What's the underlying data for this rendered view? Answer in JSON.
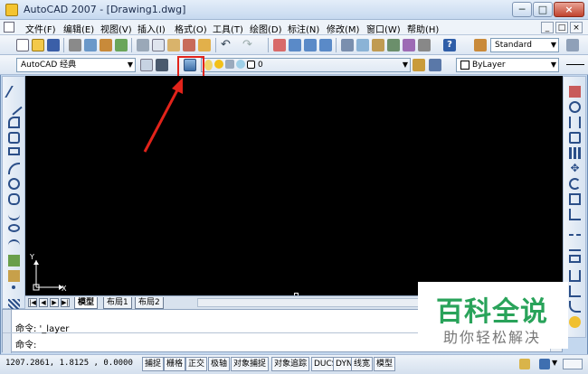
{
  "window": {
    "title": "AutoCAD 2007 - [Drawing1.dwg]",
    "min_label": "─",
    "max_label": "□",
    "close_label": "×"
  },
  "menu": {
    "items": [
      "文件(F)",
      "编辑(E)",
      "视图(V)",
      "插入(I)",
      "格式(O)",
      "工具(T)",
      "绘图(D)",
      "标注(N)",
      "修改(M)",
      "窗口(W)",
      "帮助(H)"
    ],
    "mdi_min": "_",
    "mdi_restore": "□",
    "mdi_close": "×"
  },
  "toolbar": {
    "text_style": "Standard",
    "workspace": "AutoCAD 经典",
    "layer": "0",
    "color": "ByLayer",
    "layer_properties_icon": "layer-properties-icon"
  },
  "layout_tabs": [
    "模型",
    "布局1",
    "布局2"
  ],
  "ucs": {
    "x_label": "X",
    "y_label": "Y"
  },
  "command": {
    "line1": "命令: '_layer",
    "line2": "命令:"
  },
  "status": {
    "coords": "1207.2861,  1.8125  , 0.0000",
    "buttons": [
      "捕捉",
      "栅格",
      "正交",
      "极轴",
      "对象捕捉",
      "对象追踪",
      "DUCS",
      "DYN",
      "线宽",
      "模型"
    ]
  },
  "watermark": {
    "title": "百科全说",
    "subtitle": "助你轻松解决"
  },
  "colors": {
    "highlight": "#e2231a",
    "watermark_green": "#29a35a",
    "canvas": "#000000"
  }
}
